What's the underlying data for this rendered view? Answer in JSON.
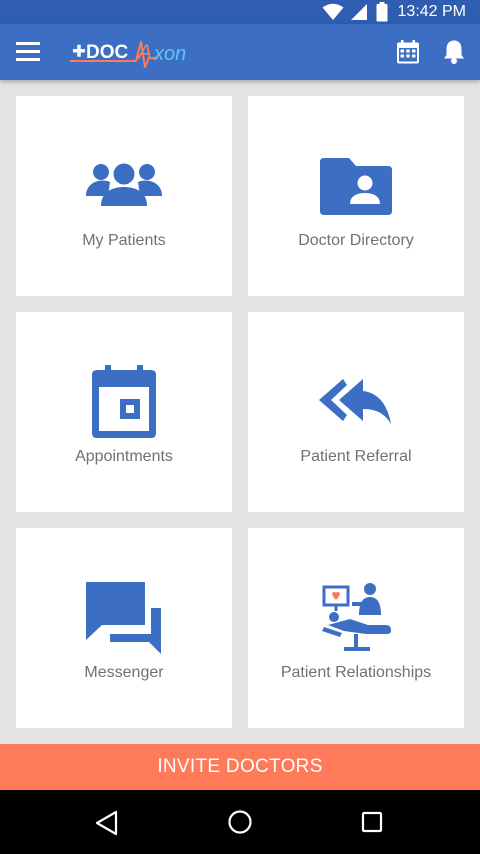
{
  "status_bar": {
    "time": "13:42 PM"
  },
  "app_bar": {
    "logo_text_left": "DOC",
    "logo_text_right": "xon",
    "logo_letter": "A"
  },
  "tiles": [
    {
      "label": "My Patients",
      "icon": "group-icon"
    },
    {
      "label": "Doctor Directory",
      "icon": "folder-person-icon"
    },
    {
      "label": "Appointments",
      "icon": "calendar-icon"
    },
    {
      "label": "Patient Referral",
      "icon": "reply-all-icon"
    },
    {
      "label": "Messenger",
      "icon": "chat-icon"
    },
    {
      "label": "Patient Relationships",
      "icon": "doctor-patient-icon"
    }
  ],
  "invite": {
    "label": "INVITE DOCTORS"
  },
  "colors": {
    "accent": "#3c6fc4",
    "invite": "#ff7a59",
    "background": "#e3e3e3"
  }
}
